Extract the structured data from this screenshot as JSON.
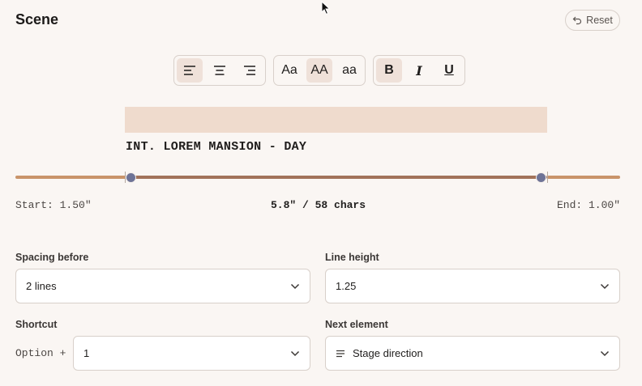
{
  "header": {
    "title": "Scene",
    "reset_label": "Reset"
  },
  "toolbar": {
    "align": [
      {
        "name": "align-left",
        "active": true
      },
      {
        "name": "align-center",
        "active": false
      },
      {
        "name": "align-right",
        "active": false
      }
    ],
    "case": [
      {
        "label": "Aa",
        "active": false
      },
      {
        "label": "AA",
        "active": true
      },
      {
        "label": "aa",
        "active": false
      }
    ],
    "style": [
      {
        "label": "B",
        "active": true
      },
      {
        "label": "I",
        "active": false
      },
      {
        "label": "U",
        "active": false
      }
    ]
  },
  "preview": {
    "text": "INT. LOREM MANSION - DAY"
  },
  "margins": {
    "start_label": "Start: 1.50\"",
    "center_label": "5.8\" / 58 chars",
    "end_label": "End: 1.00\""
  },
  "fields": {
    "spacing_before": {
      "label": "Spacing before",
      "value": "2 lines"
    },
    "line_height": {
      "label": "Line height",
      "value": "1.25"
    },
    "shortcut": {
      "label": "Shortcut",
      "prefix": "Option +",
      "value": "1"
    },
    "next_element": {
      "label": "Next element",
      "value": "Stage direction"
    }
  },
  "colors": {
    "accent": "#a2735a",
    "knob": "#6e7396",
    "band": "#efdbcd",
    "active_button": "#efe1d9"
  }
}
